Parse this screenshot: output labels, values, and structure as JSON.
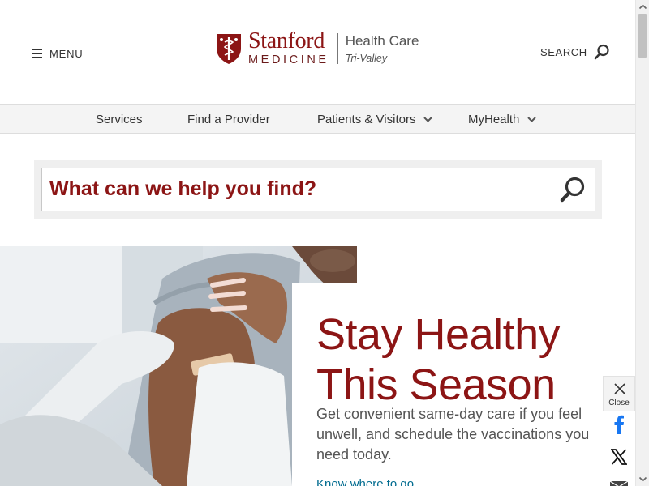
{
  "header": {
    "menu_label": "MENU",
    "logo_stanford": "Stanford",
    "logo_medicine": "MEDICINE",
    "logo_health_care": "Health Care",
    "logo_location": "Tri-Valley",
    "search_label": "SEARCH"
  },
  "nav": {
    "items": [
      {
        "label": "Services",
        "has_dropdown": false
      },
      {
        "label": "Find a Provider",
        "has_dropdown": false
      },
      {
        "label": "Patients & Visitors",
        "has_dropdown": true
      },
      {
        "label": "MyHealth",
        "has_dropdown": true
      }
    ]
  },
  "site_search": {
    "placeholder": "What can we help you find?"
  },
  "hero": {
    "title_line1": "Stay Healthy",
    "title_line2": "This Season",
    "body": "Get convenient same-day care if you feel unwell, and schedule the vaccinations you need today.",
    "link": "Know where to go"
  },
  "share": {
    "close_label": "Close",
    "icons": [
      "close-icon",
      "facebook-icon",
      "x-icon",
      "email-icon"
    ]
  },
  "colors": {
    "brand_red": "#8c1515",
    "link_teal": "#006b8f",
    "nav_bg": "#f4f4f4"
  }
}
